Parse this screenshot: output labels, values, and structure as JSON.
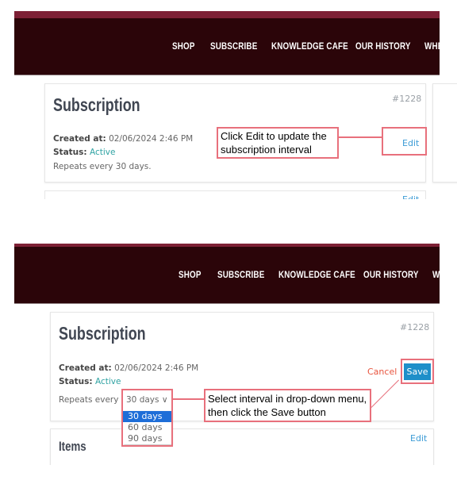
{
  "nav": {
    "items": [
      "SHOP",
      "SUBSCRIBE",
      "KNOWLEDGE CAFE",
      "OUR HISTORY",
      "WHE"
    ],
    "items2": [
      "SHOP",
      "SUBSCRIBE",
      "KNOWLEDGE CAFE",
      "OUR HISTORY",
      "W"
    ]
  },
  "subscription": {
    "title": "Subscription",
    "id": "#1228",
    "created_label": "Created at:",
    "created_value": "02/06/2024 2:46 PM",
    "status_label": "Status:",
    "status_value": "Active",
    "repeats_text": "Repeats every 30 days.",
    "repeats_label": "Repeats every",
    "edit": "Edit",
    "cancel": "Cancel",
    "save": "Save"
  },
  "interval": {
    "selected": "30 days",
    "options": [
      "30 days",
      "60 days",
      "90 days"
    ]
  },
  "items_card": {
    "title": "Items",
    "edit": "Edit"
  },
  "annotations": {
    "step1": "Click Edit to update the subscription interval",
    "step2": "Select interval in drop-down menu, then click the Save button"
  },
  "colors": {
    "header": "#2b0509",
    "strip": "#7d2035",
    "accent": "#1e8fc9",
    "cancel": "#e8553f",
    "annotation": "#e8707c"
  }
}
